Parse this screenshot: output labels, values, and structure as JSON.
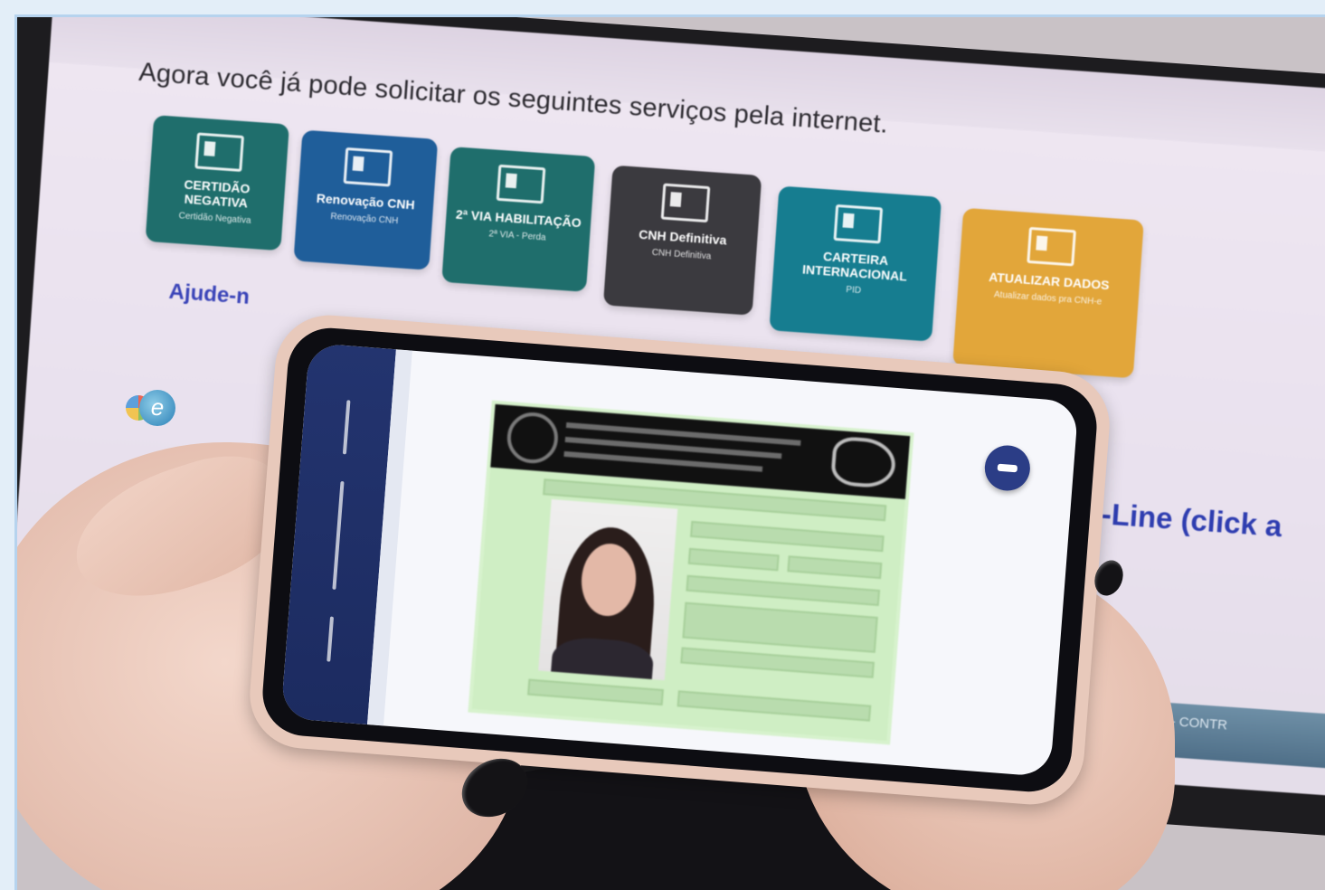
{
  "screen": {
    "headline": "Agora você já pode solicitar os seguintes serviços pela internet.",
    "tiles": [
      {
        "title": "CERTIDÃO NEGATIVA",
        "subtitle": "Certidão Negativa",
        "color": "#1f6e6c"
      },
      {
        "title": "Renovação CNH",
        "subtitle": "Renovação CNH",
        "color": "#1f5e9a"
      },
      {
        "title": "2ª VIA HABILITAÇÃO",
        "subtitle": "2ª VIA - Perda",
        "color": "#1f6e6c"
      },
      {
        "title": "CNH Definitiva",
        "subtitle": "CNH Definitiva",
        "color": "#3b3a3f"
      },
      {
        "title": "CARTEIRA INTERNACIONAL",
        "subtitle": "PID",
        "color": "#167d90"
      },
      {
        "title": "ATUALIZAR DADOS",
        "subtitle": "Atualizar dados pra CNH-e",
        "color": "#e2a63a"
      }
    ],
    "help_link": "Ajude-n",
    "online_link": "On-Line (click a",
    "taskbar_item": "12.2021 - CONTR"
  }
}
